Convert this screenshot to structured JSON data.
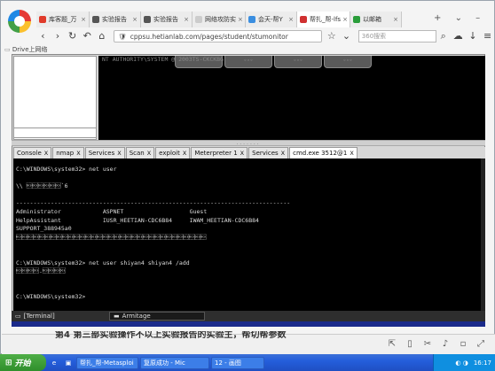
{
  "browser": {
    "tabs": [
      {
        "title": "库客题_万",
        "color": "#e03a2a",
        "active": false
      },
      {
        "title": "实验报告",
        "color": "#555555",
        "active": false
      },
      {
        "title": "实验报告",
        "color": "#555555",
        "active": false
      },
      {
        "title": "网络攻防实",
        "color": "#cccccc",
        "active": false
      },
      {
        "title": "会天-帮Y",
        "color": "#3a8ee0",
        "active": false
      },
      {
        "title": "帮扎_帮-lfs",
        "color": "#d03030",
        "active": true
      },
      {
        "title": "以邮箱",
        "color": "#2a9d3a",
        "active": false
      }
    ],
    "new_tab": "+",
    "url": "cppsu.hetianlab.com/pages/student/stumonitor",
    "search_placeholder": "360搜索",
    "bookmark": "Drive上网络"
  },
  "armitage": {
    "graph_text": "NT AUTHORITY\\SYSTEM @ 2003TS-CKCKBG",
    "console_tabs": [
      {
        "label": "Console",
        "active": false
      },
      {
        "label": "nmap",
        "active": false
      },
      {
        "label": "Services",
        "active": false
      },
      {
        "label": "Scan",
        "active": false
      },
      {
        "label": "exploit",
        "active": false
      },
      {
        "label": "Meterpreter 1",
        "active": false
      },
      {
        "label": "Services",
        "active": false
      },
      {
        "label": "cmd.exe 3512@1",
        "active": true
      }
    ],
    "terminal_lines": [
      "C:\\WINDOWS\\system32> net user",
      "",
      "\\\\ \u0013\u0013\u0013\u0013\u0013\u0013`6",
      "",
      "-------------------------------------------------------------------------------",
      "Administrator            ASPNET                   Guest",
      "HelpAssistant            IUSR_HEETIAN-CDC6B84     IWAM_HEETIAN-CDC6B84",
      "SUPPORT_388945a0",
      "\u0013\u0013\u0013\u0013\u0013\u0013\u0013\u0013\u0013\u0013\u0013\u0013\u0013\u0013\u0013\u0013\u0013\u0013\u0013\u0013\u0013\u0013\u0013\u0013\u0013\u0013\u0013\u0013\u0013\u0013\u0013\u0013\u0013",
      "",
      "",
      "C:\\WINDOWS\\system32> net user shiyan4 shiyan4 /add",
      "\u0013\u0013\u0013\u0013.\u0013\u0013\u0013\u0013",
      "",
      "",
      "C:\\WINDOWS\\system32>"
    ],
    "taskbar": [
      {
        "label": "[Terminal]",
        "active": false
      },
      {
        "label": "Armitage",
        "active": true
      }
    ]
  },
  "bottom_text": "第4 第三部实验操作不以上实验报告的实验主，帮切帮参数",
  "xp": {
    "start": "开始",
    "items": [
      "帮扎_帮-Metasploi",
      "复原成功 - Mic",
      "12 - 画图"
    ],
    "clock": "16:17"
  },
  "colors": {
    "terminal_bg": "#000000",
    "xp_blue": "#245edb"
  }
}
